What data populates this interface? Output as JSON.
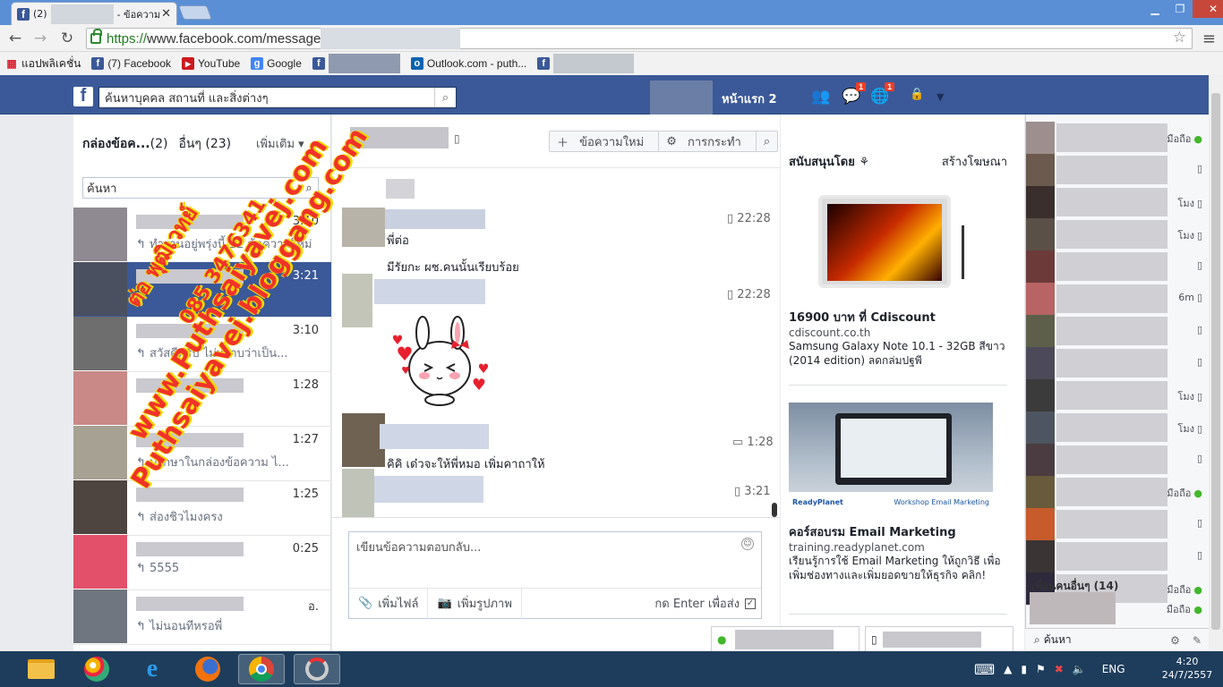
{
  "browser": {
    "tabs": [
      {
        "label": "(2)",
        "active": true
      },
      {
        "label": "- ข้อความ",
        "active": true
      }
    ],
    "url_https": "https://",
    "url_rest": "www.facebook.com/message",
    "bookmarks": [
      {
        "label": "แอปพลิเคชั่น",
        "icon": "apps-grid-icon"
      },
      {
        "label": "(7) Facebook",
        "icon": "facebook-icon"
      },
      {
        "label": "YouTube",
        "icon": "youtube-icon"
      },
      {
        "label": "Google",
        "icon": "google-icon"
      },
      {
        "label": "Outlook.com - puth...",
        "icon": "outlook-icon"
      }
    ]
  },
  "fb": {
    "search_placeholder": "ค้นหาบุคคล สถานที่ และสิ่งต่างๆ",
    "home_label": "หน้าแรก",
    "home_count": "2",
    "messages_badge": "1",
    "notifications_badge": "1"
  },
  "inbox": {
    "title": "กล่องข้อค...",
    "title_count": "(2)",
    "other": "อื่นๆ (23)",
    "more": "เพิ่มเติม",
    "search_placeholder": "ค้นหา",
    "conversations": [
      {
        "time": "3:10",
        "snippet": "ทำงานอยู่พรุ่งนี้ 12 ข้อความใหม่",
        "selected": false
      },
      {
        "time": "3:21",
        "snippet": "",
        "selected": true
      },
      {
        "time": "3:10",
        "snippet": "สวัสดีครับ ไม่ทราบว่าเป็น...",
        "selected": false
      },
      {
        "time": "1:28",
        "snippet": "",
        "selected": false
      },
      {
        "time": "1:27",
        "snippet": "ปรึกษาในกล่องข้อความ ไ...",
        "selected": false
      },
      {
        "time": "1:25",
        "snippet": "ส่องชิวไมงครง",
        "selected": false
      },
      {
        "time": "0:25",
        "snippet": "5555",
        "selected": false
      },
      {
        "time": "อ.",
        "snippet": "ไม่นอนทีหรอพี่",
        "selected": false
      }
    ]
  },
  "thread": {
    "new_message": "ข้อความใหม่",
    "actions": "การกระทำ",
    "messages": [
      {
        "time": "22:28",
        "lines": [
          "พี่ต่อ",
          "มีรัยกะ ผช.คนนั้นเรียบร้อย"
        ]
      },
      {
        "time": "22:28",
        "lines": []
      },
      {
        "time": "1:28",
        "lines": [
          "คิคิ เด๋วจะให้พี่หมอ เพิ่มคาถาให้"
        ]
      },
      {
        "time": "3:21",
        "lines": []
      }
    ],
    "composer_placeholder": "เขียนข้อความตอบกลับ...",
    "add_file": "เพิ่มไฟล์",
    "add_photo": "เพิ่มรูปภาพ",
    "enter_to_send": "กด Enter เพื่อส่ง"
  },
  "ads": {
    "heading": "สนับสนุนโดย",
    "create_ad": "สร้างโฆษณา",
    "items": [
      {
        "title": "16900 บาท ที่ Cdiscount",
        "url": "cdiscount.co.th",
        "desc": "Samsung Galaxy Note 10.1 - 32GB สีขาว (2014 edition) ลดกล่มปฐพี"
      },
      {
        "title": "คอร์สอบรม Email Marketing",
        "url": "training.readyplanet.com",
        "desc": "เรียนรู้การใช้ Email Marketing ให้ถูกวิธี เพื่อเพิ่มช่องทางและเพิ่มยอดขายให้ธุรกิจ คลิก!",
        "image_brand": "ReadyPlanet",
        "image_caption": "Workshop Email Marketing"
      }
    ]
  },
  "chat": {
    "statuses": [
      "มือถือ",
      "",
      "โมง",
      "โมง",
      "",
      "6m",
      "",
      "",
      "โมง",
      "โมง",
      "",
      "มือถือ",
      "",
      "",
      "มือถือ"
    ],
    "more_friends": "เพื่อนคนอื่นๆ (14)",
    "last_status": "มือถือ",
    "search_placeholder": "ค้นหา"
  },
  "taskbar": {
    "lang": "ENG",
    "time": "4:20",
    "date": "24/7/2557"
  },
  "watermark": {
    "line1": "ต่อ พุฒิเวทย์",
    "line2": "085 3476341",
    "line3": "www.Puthsaiyavej.com",
    "line4": "Puthsaiyavej.bloggang.com"
  },
  "colors": {
    "fb_blue": "#3b5998",
    "badge_red": "#f03d25",
    "online_green": "#42b72a"
  }
}
